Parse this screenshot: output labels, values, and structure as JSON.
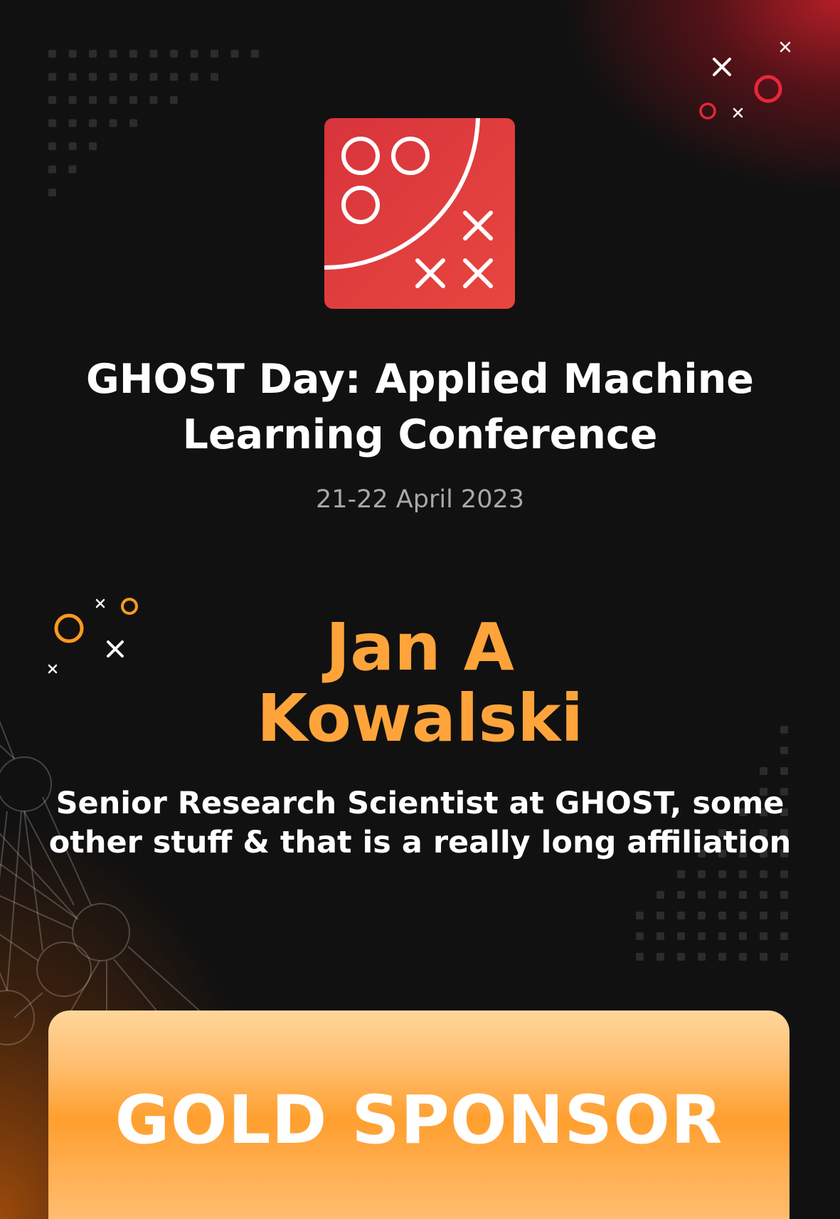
{
  "event": {
    "title": "GHOST Day:  Applied Machine\nLearning Conference",
    "date": "21-22 April 2023"
  },
  "speaker": {
    "name": "Jan A\nKowalski",
    "affiliation": "Senior Research Scientist at GHOST, some other stuff & that is a really long affiliation"
  },
  "sponsor": {
    "label": "GOLD SPONSOR"
  },
  "colors": {
    "logo_red": "#de3a3e",
    "accent_orange": "#ffa43a",
    "accent_red": "#e8263a",
    "background": "#111111"
  },
  "icons": [
    "ghost-logo-icon",
    "circle-icon",
    "cross-icon",
    "dot-grid",
    "network-graph"
  ]
}
